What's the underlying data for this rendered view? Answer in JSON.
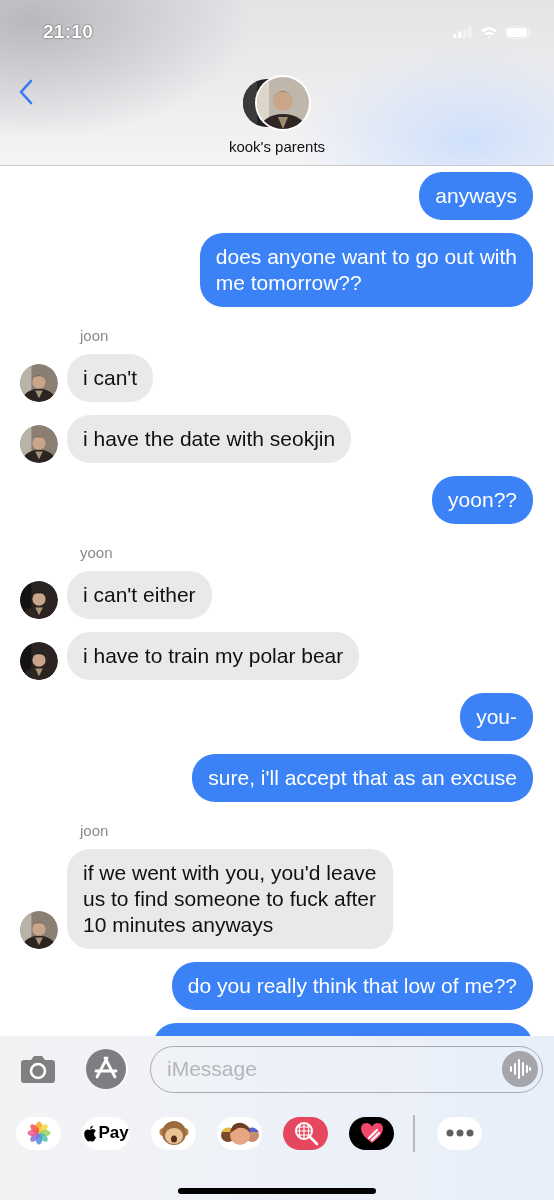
{
  "status_bar": {
    "time": "21:10"
  },
  "conversation": {
    "name": "kook's parents"
  },
  "messages": [
    {
      "kind": "sent",
      "text": "anyways"
    },
    {
      "kind": "sent",
      "lines": [
        "does anyone want to go out with",
        "me tomorrow??"
      ]
    },
    {
      "kind": "sender",
      "text": "joon"
    },
    {
      "kind": "received",
      "text": "i can't"
    },
    {
      "kind": "received",
      "text": "i have the date with seokjin"
    },
    {
      "kind": "sent",
      "text": "yoon??"
    },
    {
      "kind": "sender",
      "text": "yoon"
    },
    {
      "kind": "received",
      "text": "i can't either"
    },
    {
      "kind": "received",
      "text": "i have to train my polar bear"
    },
    {
      "kind": "sent",
      "text": "you-"
    },
    {
      "kind": "sent",
      "text": "sure, i'll accept that as an excuse"
    },
    {
      "kind": "sender",
      "text": "joon"
    },
    {
      "kind": "received",
      "lines": [
        "if we went with you, you'd leave",
        "us to find someone to fuck after",
        "10 minutes anyways"
      ]
    },
    {
      "kind": "sent",
      "text": "do you really think that low of me??"
    },
    {
      "kind": "covered"
    }
  ],
  "composer": {
    "placeholder": "iMessage"
  },
  "app_drawer": {
    "apps": [
      {
        "kind": "photos"
      },
      {
        "kind": "pay",
        "label": "Pay"
      },
      {
        "kind": "animoji"
      },
      {
        "kind": "memoji"
      },
      {
        "kind": "search"
      },
      {
        "kind": "fitness"
      },
      {
        "kind": "divider"
      },
      {
        "kind": "more"
      }
    ]
  }
}
